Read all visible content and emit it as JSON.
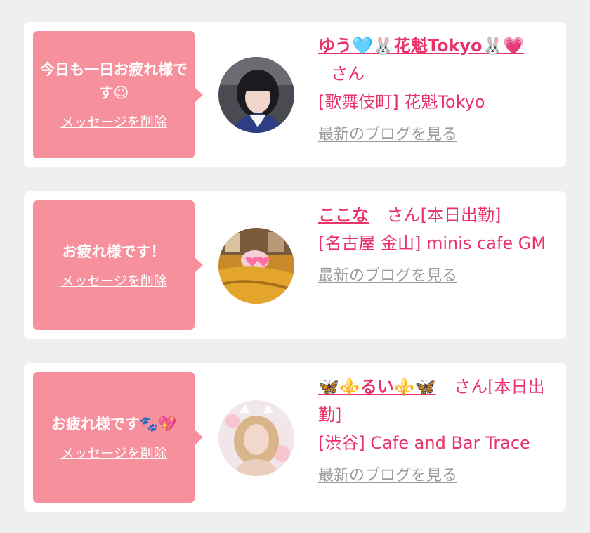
{
  "messages": [
    {
      "bubble_text": "今日も一日お疲れ様です😉",
      "delete_label": "メッセージを削除",
      "name": "ゆう🩵🐰花魁Tokyo🐰💗",
      "san": "さん",
      "status": "",
      "shop": "[歌舞伎町] 花魁Tokyo",
      "blog_label": "最新のブログを見る"
    },
    {
      "bubble_text": "お疲れ様です！",
      "delete_label": "メッセージを削除",
      "name": "ここな",
      "san": "さん",
      "status": "[本日出勤]",
      "shop": "[名古屋 金山] minis cafe GM",
      "blog_label": "最新のブログを見る"
    },
    {
      "bubble_text": "お疲れ様です🐾💖",
      "delete_label": "メッセージを削除",
      "name": "🦋⚜️るい⚜️🦋",
      "san": "さん",
      "status": "[本日出勤]",
      "shop": "[渋谷] Cafe and Bar Trace",
      "blog_label": "最新のブログを見る"
    }
  ],
  "colors": {
    "bubble": "#f7909d",
    "accent": "#e8336a",
    "link_gray": "#9a9a9a",
    "page_bg": "#efefef"
  }
}
